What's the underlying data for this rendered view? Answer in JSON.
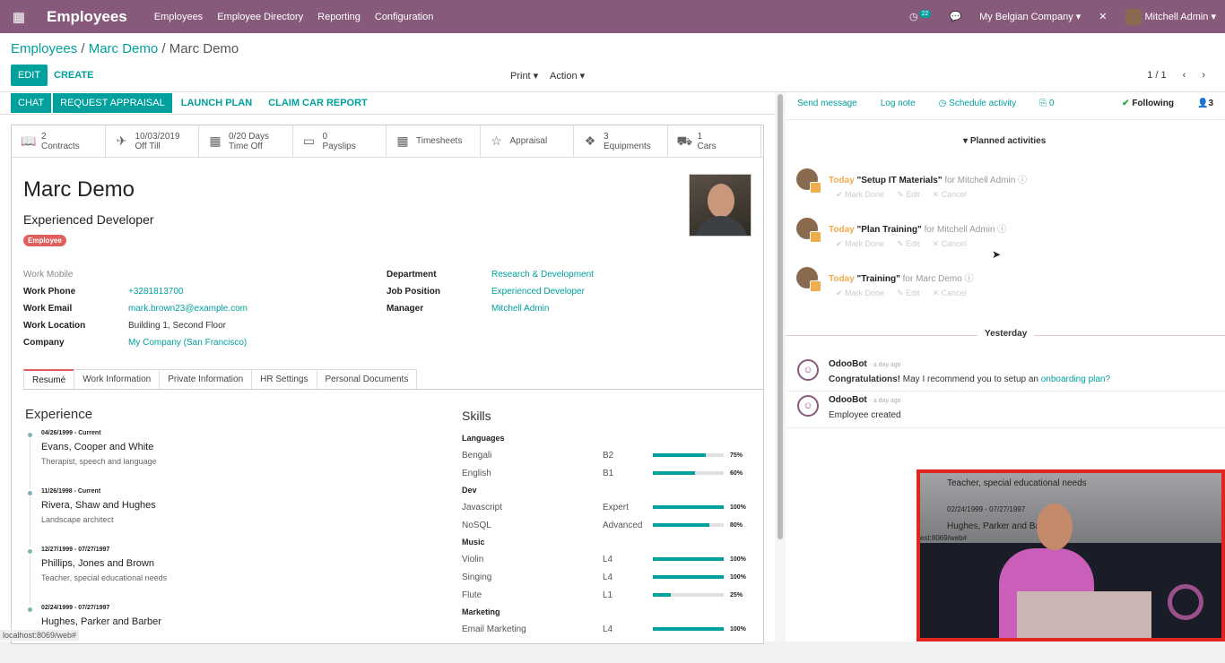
{
  "topbar": {
    "app_title": "Employees",
    "menu": [
      "Employees",
      "Employee Directory",
      "Reporting",
      "Configuration"
    ],
    "notif_count": "22",
    "company": "My Belgian Company",
    "user": "Mitchell Admin",
    "color": "#875a7b"
  },
  "breadcrumb": {
    "root": "Employees",
    "parent": "Marc Demo",
    "current": "Marc Demo"
  },
  "control": {
    "edit": "EDIT",
    "create": "CREATE",
    "print": "Print",
    "action": "Action",
    "pager": "1 / 1"
  },
  "statusbar": {
    "chat": "CHAT",
    "appraisal": "REQUEST APPRAISAL",
    "launch": "LAUNCH PLAN",
    "car": "CLAIM CAR REPORT"
  },
  "stats": [
    {
      "icon": "book-icon",
      "glyph": "📖",
      "l1": "2",
      "l2": "Contracts"
    },
    {
      "icon": "plane-icon",
      "glyph": "✈",
      "l1": "10/03/2019",
      "l2": "Off Till"
    },
    {
      "icon": "calendar-icon",
      "glyph": "▦",
      "l1": "0/20 Days",
      "l2": "Time Off"
    },
    {
      "icon": "money-icon",
      "glyph": "▭",
      "l1": "0",
      "l2": "Payslips"
    },
    {
      "icon": "calendar-icon",
      "glyph": "▦",
      "l1": "Timesheets",
      "l2": ""
    },
    {
      "icon": "star-icon",
      "glyph": "☆",
      "l1": "Appraisal",
      "l2": ""
    },
    {
      "icon": "cubes-icon",
      "glyph": "❖",
      "l1": "3",
      "l2": "Equipments"
    },
    {
      "icon": "car-icon",
      "glyph": "⛟",
      "l1": "1",
      "l2": "Cars"
    }
  ],
  "employee": {
    "name": "Marc Demo",
    "job_title": "Experienced Developer",
    "tag": "Employee",
    "work_mobile_label": "Work Mobile",
    "work_phone_label": "Work Phone",
    "work_phone": "+3281813700",
    "work_email_label": "Work Email",
    "work_email": "mark.brown23@example.com",
    "work_location_label": "Work Location",
    "work_location": "Building 1, Second Floor",
    "company_label": "Company",
    "company": "My Company (San Francisco)",
    "department_label": "Department",
    "department": "Research & Development",
    "job_position_label": "Job Position",
    "job_position": "Experienced Developer",
    "manager_label": "Manager",
    "manager": "Mitchell Admin"
  },
  "tabs": [
    "Resumé",
    "Work Information",
    "Private Information",
    "HR Settings",
    "Personal Documents"
  ],
  "experience": {
    "title": "Experience",
    "items": [
      {
        "dates": "04/26/1999 - Current",
        "company": "Evans, Cooper and White",
        "desc": "Therapist, speech and language"
      },
      {
        "dates": "11/26/1998 - Current",
        "company": "Rivera, Shaw and Hughes",
        "desc": "Landscape architect"
      },
      {
        "dates": "12/27/1999 - 07/27/1997",
        "company": "Phillips, Jones and Brown",
        "desc": "Teacher, special educational needs"
      },
      {
        "dates": "02/24/1999 - 07/27/1997",
        "company": "Hughes, Parker and Barber",
        "desc": ""
      }
    ]
  },
  "skills": {
    "title": "Skills",
    "groups": [
      {
        "name": "Languages",
        "items": [
          {
            "name": "Bengali",
            "level": "B2",
            "pct": "75%",
            "value": 0.75
          },
          {
            "name": "English",
            "level": "B1",
            "pct": "60%",
            "value": 0.6
          }
        ]
      },
      {
        "name": "Dev",
        "items": [
          {
            "name": "Javascript",
            "level": "Expert",
            "pct": "100%",
            "value": 1.0
          },
          {
            "name": "NoSQL",
            "level": "Advanced",
            "pct": "80%",
            "value": 0.8
          }
        ]
      },
      {
        "name": "Music",
        "items": [
          {
            "name": "Violin",
            "level": "L4",
            "pct": "100%",
            "value": 1.0
          },
          {
            "name": "Singing",
            "level": "L4",
            "pct": "100%",
            "value": 1.0
          },
          {
            "name": "Flute",
            "level": "L1",
            "pct": "25%",
            "value": 0.25
          }
        ]
      },
      {
        "name": "Marketing",
        "items": [
          {
            "name": "Email Marketing",
            "level": "L4",
            "pct": "100%",
            "value": 1.0
          }
        ]
      }
    ]
  },
  "chatter": {
    "send_message": "Send message",
    "log_note": "Log note",
    "schedule": "Schedule activity",
    "attachments": "0",
    "following": "Following",
    "followers": "3",
    "planned": "Planned activities",
    "activities": [
      {
        "when": "Today",
        "title": "\"Setup IT Materials\"",
        "for": "for Mitchell Admin"
      },
      {
        "when": "Today",
        "title": "\"Plan Training\"",
        "for": "for Mitchell Admin"
      },
      {
        "when": "Today",
        "title": "\"Training\"",
        "for": "for Marc Demo"
      }
    ],
    "act_actions": [
      "Mark Done",
      "Edit",
      "Cancel"
    ],
    "yesterday": "Yesterday",
    "messages": [
      {
        "author": "OdooBot",
        "ago": "- a day ago",
        "bold": "Congratulations!",
        "text": " May I recommend you to setup an ",
        "link": "onboarding plan?"
      },
      {
        "author": "OdooBot",
        "ago": "- a day ago",
        "bold": "",
        "text": "Employee created",
        "link": ""
      }
    ]
  },
  "video": {
    "line1": "Teacher, special educational needs",
    "line2": "02/24/1999 - 07/27/1997",
    "line3": "Hughes, Parker and Barber",
    "line4": "est:8069/web#"
  },
  "status_url": "localhost:8069/web#"
}
